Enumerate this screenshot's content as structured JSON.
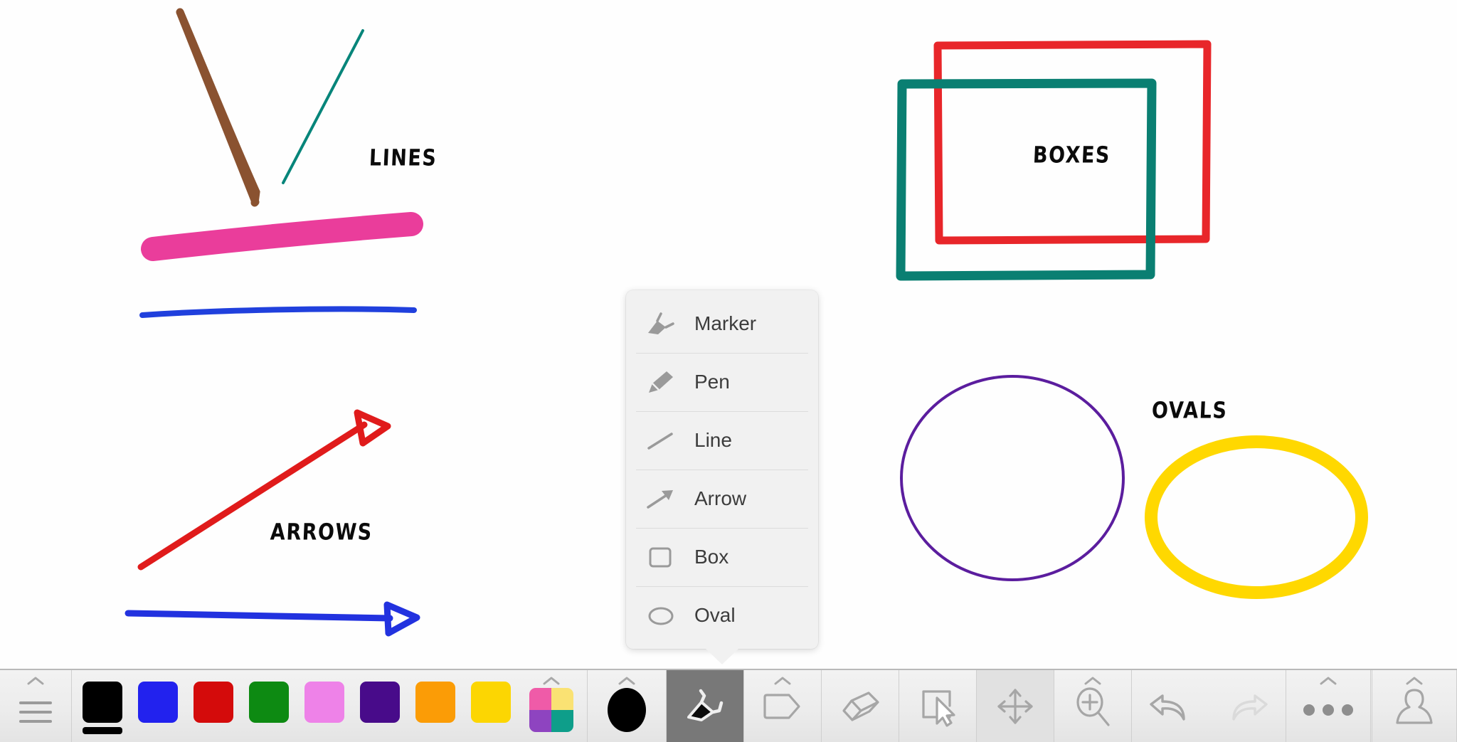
{
  "app": {
    "canvas_background": "#fefefe",
    "toolbar_background": "#ececec"
  },
  "canvas": {
    "labels": {
      "lines": "LINES",
      "boxes": "BOXES",
      "arrows": "ARROWS",
      "ovals": "OVALS"
    },
    "drawings": [
      {
        "name": "brown-diagonal-line",
        "type": "line",
        "color": "#8a5230",
        "stroke": 11
      },
      {
        "name": "teal-diagonal-line",
        "type": "line",
        "color": "#07857a",
        "stroke": 4
      },
      {
        "name": "magenta-thick-line",
        "type": "line",
        "color": "#ea3d9b",
        "stroke": 32
      },
      {
        "name": "blue-straight-line",
        "type": "line",
        "color": "#2040dd",
        "stroke": 8
      },
      {
        "name": "red-diagonal-arrow",
        "type": "arrow",
        "color": "#e01b1b",
        "stroke": 9
      },
      {
        "name": "blue-horizontal-arrow",
        "type": "arrow",
        "color": "#2232df",
        "stroke": 9
      },
      {
        "name": "red-box",
        "type": "box",
        "color": "#e8262a",
        "stroke": 11
      },
      {
        "name": "teal-box",
        "type": "box",
        "color": "#0a7f72",
        "stroke": 13
      },
      {
        "name": "purple-oval",
        "type": "oval",
        "color": "#5b1d9e",
        "stroke": 4
      },
      {
        "name": "yellow-oval",
        "type": "oval",
        "color": "#ffd800",
        "stroke": 18
      }
    ]
  },
  "popup": {
    "visible": true,
    "items": [
      {
        "icon": "marker-icon",
        "label": "Marker"
      },
      {
        "icon": "pen-icon",
        "label": "Pen"
      },
      {
        "icon": "line-icon",
        "label": "Line"
      },
      {
        "icon": "arrow-icon",
        "label": "Arrow"
      },
      {
        "icon": "box-icon",
        "label": "Box"
      },
      {
        "icon": "oval-icon",
        "label": "Oval"
      }
    ]
  },
  "toolbar": {
    "menu": {
      "icon": "hamburger-icon",
      "label": "Menu",
      "has_chevron": true
    },
    "colors": [
      {
        "name": "black",
        "hex": "#000000",
        "selected": true
      },
      {
        "name": "blue",
        "hex": "#2222ee",
        "selected": false
      },
      {
        "name": "red",
        "hex": "#d40b0b",
        "selected": false
      },
      {
        "name": "green",
        "hex": "#0d8a12",
        "selected": false
      },
      {
        "name": "pink",
        "hex": "#ee82e8",
        "selected": false
      },
      {
        "name": "purple",
        "hex": "#480b8a",
        "selected": false
      },
      {
        "name": "orange",
        "hex": "#fb9c06",
        "selected": false
      },
      {
        "name": "yellow",
        "hex": "#fcd602",
        "selected": false
      }
    ],
    "palette": {
      "label": "More colors",
      "has_chevron": true,
      "quadrants": [
        "#ef5ba8",
        "#fae273",
        "#8e44c0",
        "#0e9e8a"
      ]
    },
    "stroke": {
      "label": "Stroke width",
      "has_chevron": true,
      "icon": "filled-circle-icon"
    },
    "tools": [
      {
        "name": "marker-tool",
        "label": "Marker",
        "icon": "marker-icon",
        "selected": true,
        "has_chevron": false
      },
      {
        "name": "shape-tool",
        "label": "Shape",
        "icon": "pentagon-icon",
        "selected": false,
        "has_chevron": true
      },
      {
        "name": "eraser-tool",
        "label": "Eraser",
        "icon": "eraser-icon",
        "selected": false,
        "has_chevron": false
      },
      {
        "name": "select-tool",
        "label": "Select",
        "icon": "select-cursor-icon",
        "selected": false,
        "has_chevron": false
      },
      {
        "name": "move-tool",
        "label": "Move",
        "icon": "move-arrows-icon",
        "selected": false,
        "has_chevron": false,
        "active": true
      },
      {
        "name": "zoom-tool",
        "label": "Zoom",
        "icon": "magnifier-plus-icon",
        "selected": false,
        "has_chevron": true
      }
    ],
    "history": [
      {
        "name": "undo-button",
        "label": "Undo",
        "icon": "undo-arrow-icon",
        "enabled": true
      },
      {
        "name": "redo-button",
        "label": "Redo",
        "icon": "redo-arrow-icon",
        "enabled": false
      }
    ],
    "more": {
      "label": "More",
      "icon": "ellipsis-icon",
      "has_chevron": true
    },
    "account": {
      "label": "Account",
      "icon": "person-icon",
      "has_chevron": true
    }
  }
}
